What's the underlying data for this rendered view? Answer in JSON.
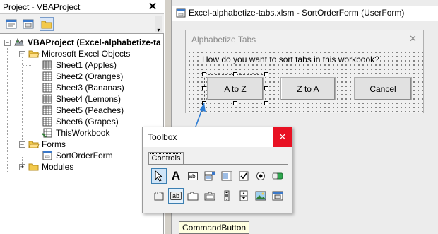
{
  "project": {
    "title": "Project - VBAProject",
    "close_glyph": "✕",
    "toolbar": [
      "view-code-icon",
      "view-object-icon",
      "toggle-folders-icon"
    ],
    "tree": {
      "root": "VBAProject (Excel-alphabetize-ta",
      "excel_objects": "Microsoft Excel Objects",
      "sheets": [
        "Sheet1 (Apples)",
        "Sheet2 (Oranges)",
        "Sheet3 (Bananas)",
        "Sheet4 (Lemons)",
        "Sheet5 (Peaches)",
        "Sheet6 (Grapes)"
      ],
      "workbook": "ThisWorkbook",
      "forms": "Forms",
      "form_item": "SortOrderForm",
      "modules": "Modules"
    }
  },
  "designer": {
    "window_title": "Excel-alphabetize-tabs.xlsm - SortOrderForm (UserForm)",
    "form": {
      "caption": "Alphabetize Tabs",
      "close_glyph": "✕",
      "question": "How do you want to sort tabs in this workbook?",
      "buttons": [
        "A to Z",
        "Z to A",
        "Cancel"
      ]
    }
  },
  "toolbox": {
    "title": "Toolbox",
    "close_glyph": "✕",
    "tab": "Controls",
    "tools_row1": [
      "select-objects-icon",
      "label-icon",
      "textbox-icon",
      "combobox-icon",
      "listbox-icon",
      "checkbox-icon",
      "optionbutton-icon",
      "togglebutton-icon"
    ],
    "tools_row2": [
      "frame-icon",
      "commandbutton-icon",
      "tabstrip-icon",
      "multipage-icon",
      "scrollbar-icon",
      "spinbutton-icon",
      "image-icon",
      "refedit-icon"
    ],
    "label_glyph": "A",
    "textbox_glyph": "abl",
    "frame_glyph": "XY",
    "commandbutton_glyph": "ab"
  },
  "tooltip": "CommandButton",
  "colors": {
    "accent": "#2b7bd3",
    "close_red": "#e81123"
  }
}
